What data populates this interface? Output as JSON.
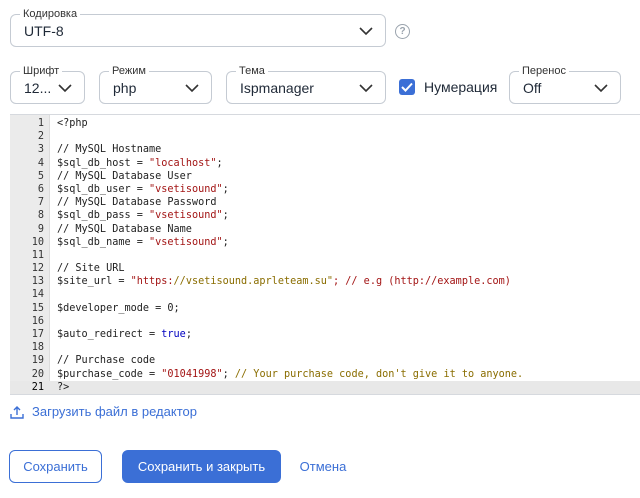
{
  "encoding": {
    "label": "Кодировка",
    "value": "UTF-8"
  },
  "font": {
    "label": "Шрифт",
    "value": "12..."
  },
  "mode": {
    "label": "Режим",
    "value": "php"
  },
  "theme": {
    "label": "Тема",
    "value": "Ispmanager"
  },
  "numbering": {
    "label": "Нумерация",
    "checked": true
  },
  "wrap": {
    "label": "Перенос",
    "value": "Off"
  },
  "editor": {
    "active_line": 21,
    "lines": [
      {
        "n": "1",
        "text": "<?php"
      },
      {
        "n": "2",
        "text": ""
      },
      {
        "n": "3",
        "text": "// MySQL Hostname"
      },
      {
        "n": "4",
        "text": "$sql_db_host = \"localhost\";"
      },
      {
        "n": "5",
        "text": "// MySQL Database User"
      },
      {
        "n": "6",
        "text": "$sql_db_user = \"vsetisound\";"
      },
      {
        "n": "7",
        "text": "// MySQL Database Password"
      },
      {
        "n": "8",
        "text": "$sql_db_pass = \"vsetisound\";"
      },
      {
        "n": "9",
        "text": "// MySQL Database Name"
      },
      {
        "n": "10",
        "text": "$sql_db_name = \"vsetisound\";"
      },
      {
        "n": "11",
        "text": ""
      },
      {
        "n": "12",
        "text": "// Site URL"
      },
      {
        "n": "13",
        "text": "$site_url = \"https://vsetisound.aprleteam.su\"; // e.g (http://example.com)"
      },
      {
        "n": "14",
        "text": ""
      },
      {
        "n": "15",
        "text": "$developer_mode = 0;"
      },
      {
        "n": "16",
        "text": ""
      },
      {
        "n": "17",
        "text": "$auto_redirect = true;"
      },
      {
        "n": "18",
        "text": ""
      },
      {
        "n": "19",
        "text": "// Purchase code"
      },
      {
        "n": "20",
        "text": "$purchase_code = \"01041998\"; // Your purchase code, don't give it to anyone."
      },
      {
        "n": "21",
        "text": "?>"
      }
    ]
  },
  "upload": {
    "label": "Загрузить файл в редактор"
  },
  "buttons": {
    "save": "Сохранить",
    "save_close": "Сохранить и закрыть",
    "cancel": "Отмена"
  },
  "colors": {
    "accent": "#3b6fd6",
    "comment": "#8a6d00",
    "string": "#a31515",
    "keyword": "#0000c0"
  },
  "icons": {
    "help": "question-circle-icon",
    "chevron": "chevron-down-icon",
    "upload": "upload-file-icon",
    "check": "checkmark-icon"
  }
}
